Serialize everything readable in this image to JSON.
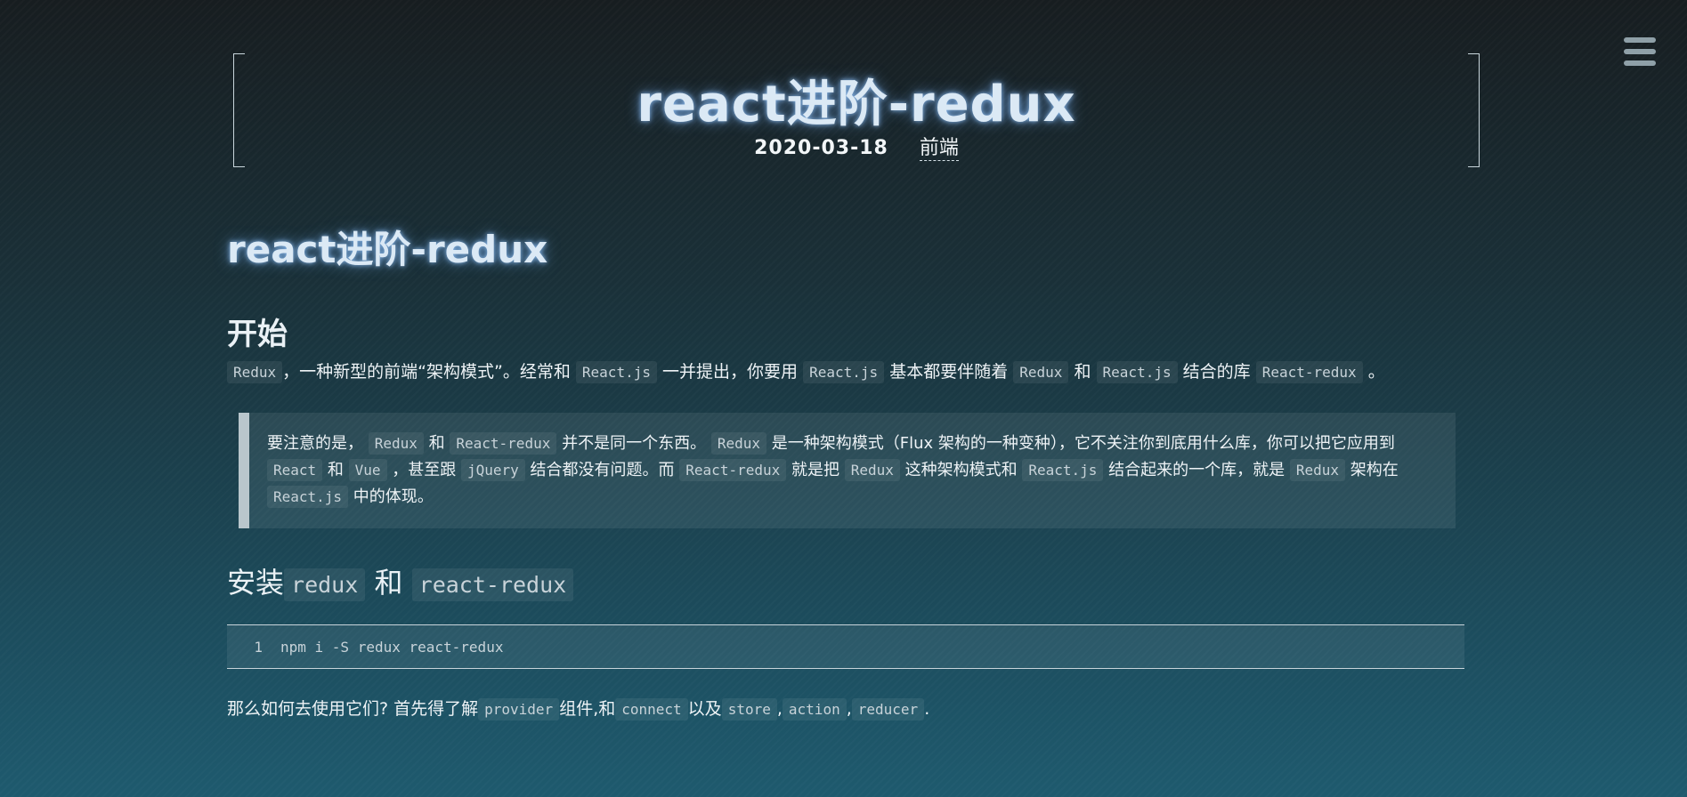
{
  "header": {
    "title": "react进阶-redux",
    "date": "2020-03-18",
    "category": "前端"
  },
  "content": {
    "h1": "react进阶-redux",
    "section_start": {
      "heading": "开始",
      "p": {
        "c1": "Redux",
        "t1": "，一种新型的前端“架构模式”。经常和",
        "c2": "React.js",
        "t2": "一并提出，你要用",
        "c3": "React.js",
        "t3": "基本都要伴随着",
        "c4": "Redux",
        "t4": "和",
        "c5": "React.js",
        "t5": "结合的库",
        "c6": "React-redux",
        "t6": "。"
      }
    },
    "quote": {
      "t1": "要注意的是，",
      "c1": "Redux",
      "t2": "和",
      "c2": "React-redux",
      "t3": "并不是同一个东西。",
      "c3": "Redux",
      "t4": "是一种架构模式（Flux 架构的一种变种），它不关注你到底用什么库，你可以把它应用到",
      "c4": "React",
      "t5": "和",
      "c5": "Vue",
      "t6": "，甚至跟",
      "c6": "jQuery",
      "t7": "结合都没有问题。而",
      "c7": "React-redux",
      "t8": "就是把",
      "c8": "Redux",
      "t9": "这种架构模式和",
      "c9": "React.js",
      "t10": "结合起来的一个库，就是",
      "c10": "Redux",
      "t11": "架构在",
      "c11": "React.js",
      "t12": "中的体现。"
    },
    "section_install": {
      "t1": "安装",
      "c1": "redux",
      "t2": "和",
      "c2": "react-redux"
    },
    "code": {
      "line_no": "1",
      "line": "npm i -S redux react-redux"
    },
    "after": {
      "t1": "那么如何去使用它们? 首先得了解",
      "c1": "provider",
      "t2": "组件,和",
      "c2": "connect",
      "t3": "以及",
      "c3": "store",
      "t4": ",",
      "c4": "action",
      "t5": ",",
      "c5": "reducer",
      "t6": "."
    }
  }
}
